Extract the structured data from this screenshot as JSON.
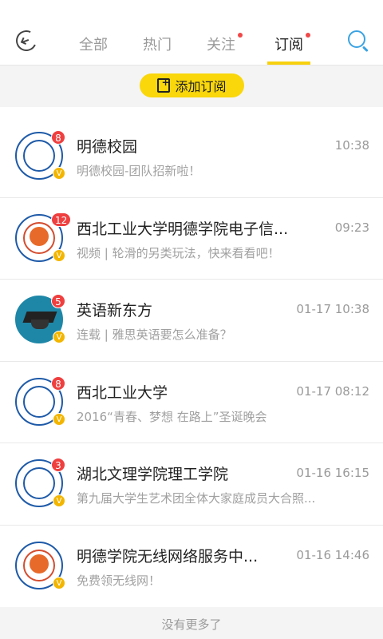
{
  "tabs": [
    {
      "label": "全部"
    },
    {
      "label": "热门"
    },
    {
      "label": "关注"
    },
    {
      "label": "订阅"
    }
  ],
  "add_button_label": "添加订阅",
  "items": [
    {
      "title": "明德校园",
      "time": "10:38",
      "subtitle": "明德校园-团队招新啦！",
      "badge": "8"
    },
    {
      "title": "西北工业大学明德学院电子信...",
      "time": "09:23",
      "subtitle": "视频 | 轮滑的另类玩法，快来看看吧！",
      "badge": "12"
    },
    {
      "title": "英语新东方",
      "time": "01-17 10:38",
      "subtitle": "连载 | 雅思英语要怎么准备？",
      "badge": "5"
    },
    {
      "title": "西北工业大学",
      "time": "01-17 08:12",
      "subtitle": "2016“青春、梦想 在路上”圣诞晚会",
      "badge": "8"
    },
    {
      "title": "湖北文理学院理工学院",
      "time": "01-16 16:15",
      "subtitle": "第九届大学生艺术团全体大家庭成员大合照...",
      "badge": "3"
    },
    {
      "title": "明德学院无线网络服务中...",
      "time": "01-16 14:46",
      "subtitle": "免费领无线网！",
      "badge": ""
    }
  ],
  "verified_mark": "V",
  "footer_text": "没有更多了",
  "colors": {
    "accent": "#f9d70b",
    "badge": "#ef3f3f",
    "search": "#3aa3e3"
  }
}
